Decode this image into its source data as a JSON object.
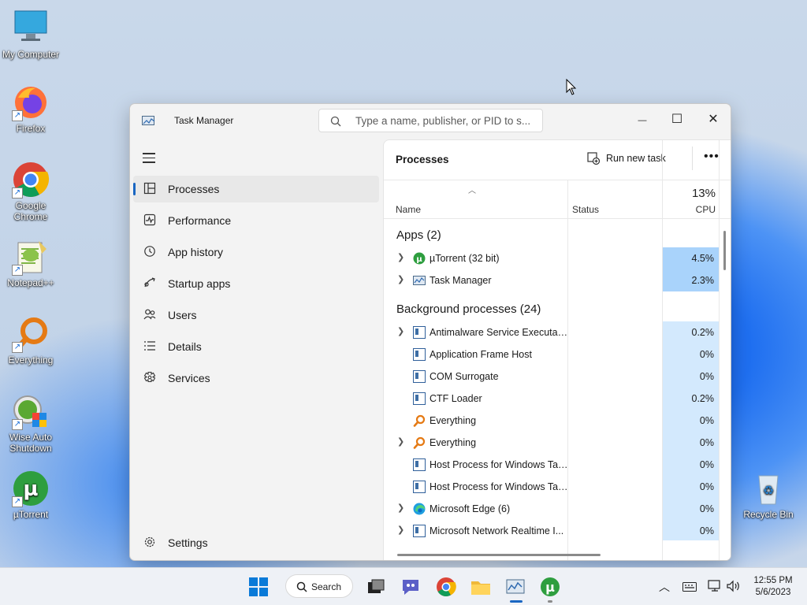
{
  "desktop": {
    "icons": [
      {
        "label": "My Computer"
      },
      {
        "label": "Firefox"
      },
      {
        "label": "Google Chrome"
      },
      {
        "label": "Notepad++"
      },
      {
        "label": "Everything"
      },
      {
        "label": "Wise Auto Shutdown"
      },
      {
        "label": "µTorrent"
      },
      {
        "label": "Recycle Bin"
      }
    ]
  },
  "window": {
    "title": "Task Manager",
    "search_placeholder": "Type a name, publisher, or PID to s...",
    "controls": {
      "minimize": "—",
      "maximize": "☐",
      "close": "✕"
    }
  },
  "sidebar": {
    "items": [
      {
        "label": "Processes",
        "icon": "processes-icon",
        "active": true
      },
      {
        "label": "Performance",
        "icon": "performance-icon"
      },
      {
        "label": "App history",
        "icon": "app-history-icon"
      },
      {
        "label": "Startup apps",
        "icon": "startup-apps-icon"
      },
      {
        "label": "Users",
        "icon": "users-icon"
      },
      {
        "label": "Details",
        "icon": "details-icon"
      },
      {
        "label": "Services",
        "icon": "services-icon"
      }
    ],
    "settings": "Settings"
  },
  "main": {
    "title": "Processes",
    "run_new_task": "Run new task",
    "more": "•••",
    "columns": {
      "name": "Name",
      "status": "Status",
      "cpu_total": "13%",
      "cpu": "CPU"
    },
    "groups": [
      {
        "label": "Apps (2)",
        "rows": [
          {
            "name": "µTorrent (32 bit)",
            "cpu": "4.5%",
            "expand": true,
            "icon": "utorrent-icon"
          },
          {
            "name": "Task Manager",
            "cpu": "2.3%",
            "expand": true,
            "icon": "task-manager-icon"
          }
        ]
      },
      {
        "label": "Background processes (24)",
        "rows": [
          {
            "name": "Antimalware Service Executable",
            "cpu": "0.2%",
            "expand": true,
            "icon": "window-icon"
          },
          {
            "name": "Application Frame Host",
            "cpu": "0%",
            "expand": false,
            "icon": "window-icon"
          },
          {
            "name": "COM Surrogate",
            "cpu": "0%",
            "expand": false,
            "icon": "window-icon"
          },
          {
            "name": "CTF Loader",
            "cpu": "0.2%",
            "expand": false,
            "icon": "window-icon"
          },
          {
            "name": "Everything",
            "cpu": "0%",
            "expand": false,
            "icon": "everything-icon"
          },
          {
            "name": "Everything",
            "cpu": "0%",
            "expand": true,
            "icon": "everything-icon"
          },
          {
            "name": "Host Process for Windows Tasks",
            "cpu": "0%",
            "expand": false,
            "icon": "window-icon"
          },
          {
            "name": "Host Process for Windows Tasks",
            "cpu": "0%",
            "expand": false,
            "icon": "window-icon"
          },
          {
            "name": "Microsoft Edge (6)",
            "cpu": "0%",
            "expand": true,
            "icon": "edge-icon"
          },
          {
            "name": "Microsoft Network Realtime I...",
            "cpu": "0%",
            "expand": true,
            "icon": "window-icon"
          }
        ]
      }
    ]
  },
  "taskbar": {
    "search_label": "Search",
    "clock_time": "12:55 PM",
    "clock_date": "5/6/2023"
  },
  "colors": {
    "accent": "#1a66c2",
    "cpu_high": "#a9d3fb",
    "cpu_low": "#d3e9fd"
  }
}
